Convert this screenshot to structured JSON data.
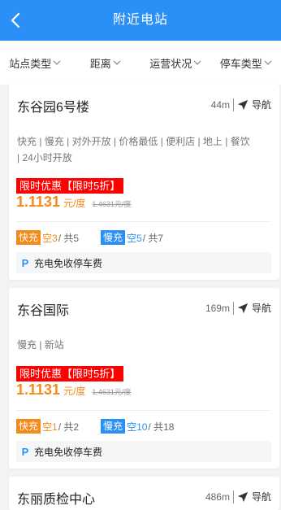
{
  "header": {
    "title": "附近电站"
  },
  "filters": [
    {
      "label": "站点类型"
    },
    {
      "label": "距离"
    },
    {
      "label": "运营状况"
    },
    {
      "label": "停车类型"
    }
  ],
  "nav_label": "导航",
  "colors": {
    "primary": "#2a8ff7",
    "promo": "#ff0000",
    "accent": "#f58a1c"
  },
  "stations": [
    {
      "name": "东谷园6号楼",
      "distance": "44m",
      "tags_line1": "快充 | 慢充 | 对外开放 | 价格最低 | 便利店 | 地上 | 餐饮",
      "tags_line2": "| 24小时开放",
      "promo": "限时优惠【限时5折】",
      "price": "1.1131",
      "unit": "元/度",
      "old_price": "1.4631元/度",
      "fast_label": "快充",
      "fast_free": "空3",
      "fast_total": "/ 共5",
      "slow_label": "慢充",
      "slow_free": "空5",
      "slow_total": "/ 共7",
      "parking_icon": "P",
      "parking_note": "充电免收停车费"
    },
    {
      "name": "东谷国际",
      "distance": "169m",
      "tags_line1": "慢充 | 新站",
      "promo": "限时优惠【限时5折】",
      "price": "1.1131",
      "unit": "元/度",
      "old_price": "1.4631元/度",
      "fast_label": "快充",
      "fast_free": "空1",
      "fast_total": "/ 共2",
      "slow_label": "慢充",
      "slow_free": "空10",
      "slow_total": "/ 共18",
      "parking_icon": "P",
      "parking_note": "充电免收停车费"
    },
    {
      "name": "东丽质检中心",
      "distance": "486m"
    }
  ]
}
